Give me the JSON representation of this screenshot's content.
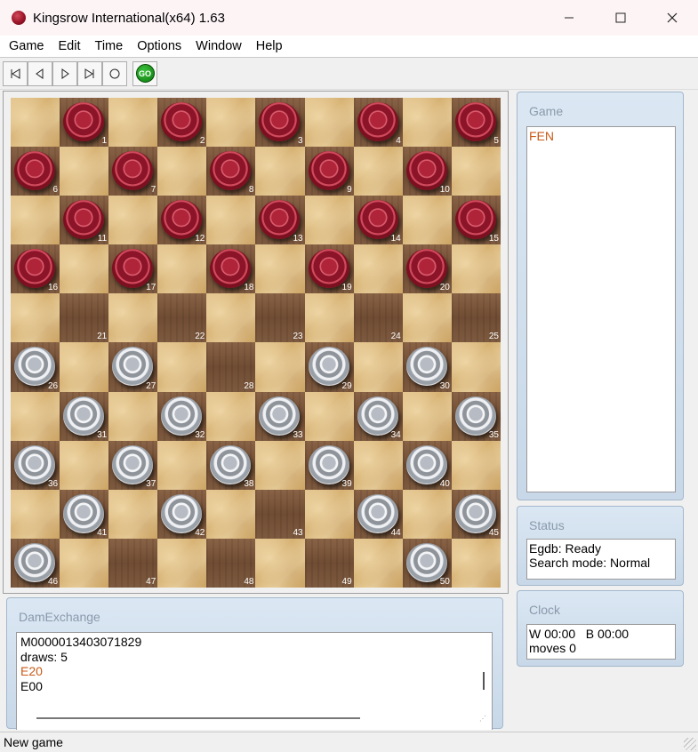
{
  "window": {
    "title": "Kingsrow International(x64) 1.63",
    "minimize_icon": "minimize-icon",
    "maximize_icon": "maximize-icon",
    "close_icon": "close-icon"
  },
  "menu": [
    "Game",
    "Edit",
    "Time",
    "Options",
    "Window",
    "Help"
  ],
  "toolbar": {
    "buttons": [
      "first-move-icon",
      "previous-move-icon",
      "next-move-icon",
      "last-move-icon",
      "circle-icon"
    ],
    "go_label": "GO"
  },
  "board": {
    "size": 10,
    "numbers": [
      "1",
      "2",
      "3",
      "4",
      "5",
      "6",
      "7",
      "8",
      "9",
      "10",
      "11",
      "12",
      "13",
      "14",
      "15",
      "16",
      "17",
      "18",
      "19",
      "20",
      "21",
      "22",
      "23",
      "24",
      "25",
      "26",
      "27",
      "28",
      "29",
      "30",
      "31",
      "32",
      "33",
      "34",
      "35",
      "36",
      "37",
      "38",
      "39",
      "40",
      "41",
      "42",
      "43",
      "44",
      "45",
      "46",
      "47",
      "48",
      "49",
      "50"
    ],
    "red_squares": [
      1,
      2,
      3,
      4,
      5,
      6,
      7,
      8,
      9,
      10,
      11,
      12,
      13,
      14,
      15,
      16,
      17,
      18,
      19,
      20
    ],
    "white_squares": [
      26,
      27,
      29,
      30,
      31,
      32,
      33,
      34,
      35,
      36,
      37,
      38,
      39,
      40,
      41,
      42,
      44,
      45,
      46,
      50
    ],
    "piece_colors": {
      "red": "#9b1528",
      "white": "#d7dade"
    }
  },
  "panels": {
    "game": {
      "title": "Game",
      "text": "FEN"
    },
    "status": {
      "title": "Status",
      "line1": "Egdb: Ready",
      "line2": "Search mode: Normal"
    },
    "clock": {
      "title": "Clock",
      "line1": "W 00:00   B 00:00",
      "line2": "moves 0"
    },
    "damexchange": {
      "title": "DamExchange",
      "lines": [
        "M0000013403071829",
        "draws: 5",
        "E20",
        "E00"
      ]
    }
  },
  "statusbar": {
    "text": "New game"
  },
  "colors": {
    "accent_orange": "#c85a17",
    "panel_bg": "#dbe7f3"
  }
}
